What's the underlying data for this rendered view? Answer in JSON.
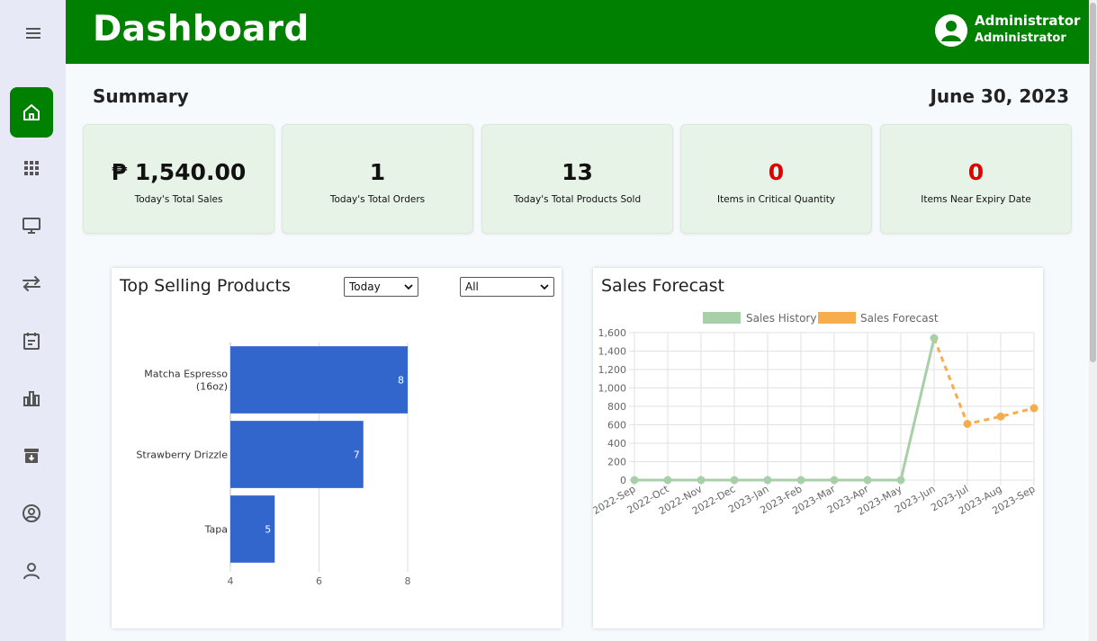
{
  "header": {
    "title": "Dashboard",
    "user_name": "Administrator",
    "user_role": "Administrator"
  },
  "sidebar": {
    "items": [
      {
        "icon": "home-icon",
        "active": true
      },
      {
        "icon": "grid-icon"
      },
      {
        "icon": "monitor-icon"
      },
      {
        "icon": "arrows-exchange-icon"
      },
      {
        "icon": "calendar-icon"
      },
      {
        "icon": "bar-chart-icon"
      },
      {
        "icon": "archive-icon"
      },
      {
        "icon": "user-circle-icon"
      },
      {
        "icon": "user-icon"
      }
    ]
  },
  "summary": {
    "title": "Summary",
    "date": "June 30, 2023",
    "cards": [
      {
        "value": "₱ 1,540.00",
        "label": "Today's Total Sales"
      },
      {
        "value": "1",
        "label": "Today's Total Orders"
      },
      {
        "value": "13",
        "label": "Today's Total Products Sold"
      },
      {
        "value": "0",
        "label": "Items in Critical Quantity"
      },
      {
        "value": "0",
        "label": "Items Near Expiry Date"
      }
    ]
  },
  "top_selling": {
    "title": "Top Selling Products",
    "period_select": "Today",
    "category_select": "All"
  },
  "forecast": {
    "title": "Sales Forecast"
  },
  "colors": {
    "brand_green": "#008000",
    "bar_blue": "#3366cc",
    "history_green": "#a8d0a8",
    "forecast_orange": "#f7ad4b",
    "alert_red": "#e00000"
  },
  "chart_data": [
    {
      "type": "bar",
      "orientation": "horizontal",
      "categories": [
        [
          "Matcha Espresso",
          "(16oz)"
        ],
        "Strawberry Drizzle",
        "Tapa"
      ],
      "values": [
        8,
        7,
        5
      ],
      "xlim": [
        4,
        8
      ],
      "xticks": [
        "4",
        "6",
        "8"
      ],
      "grid": true
    },
    {
      "type": "line",
      "x": [
        "2022-Sep",
        "2022-Oct",
        "2022-Nov",
        "2022-Dec",
        "2023-Jan",
        "2023-Feb",
        "2023-Mar",
        "2023-Apr",
        "2023-May",
        "2023-Jun",
        "2023-Jul",
        "2023-Aug",
        "2023-Sep"
      ],
      "series": [
        {
          "name": "Sales History",
          "values": [
            0,
            0,
            0,
            0,
            0,
            0,
            0,
            0,
            0,
            1540,
            null,
            null,
            null
          ]
        },
        {
          "name": "Sales Forecast",
          "values": [
            null,
            null,
            null,
            null,
            null,
            null,
            null,
            null,
            null,
            1540,
            610,
            690,
            780
          ]
        }
      ],
      "yticks": [
        "0",
        "200",
        "400",
        "600",
        "800",
        "1,000",
        "1,200",
        "1,400",
        "1,600"
      ],
      "ylim": [
        0,
        1600
      ],
      "legend": "top",
      "grid": true
    }
  ]
}
